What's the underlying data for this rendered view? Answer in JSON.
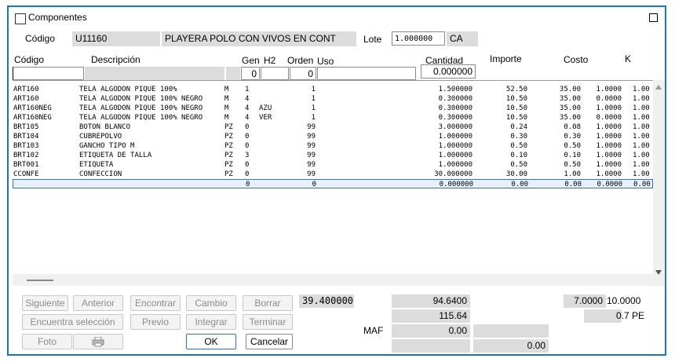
{
  "window": {
    "title": "Componentes"
  },
  "header": {
    "codigo_label": "Código",
    "codigo_value": "U11160",
    "descripcion_value": "PLAYERA POLO CON VIVOS EN CONT",
    "lote_label": "Lote",
    "lote_value": "1.000000",
    "unidad_value": "CA"
  },
  "columns": {
    "codigo": "Código",
    "descripcion": "Descripción",
    "gen": "Gen",
    "h2": "H2",
    "orden": "Orden",
    "uso": "Uso",
    "cantidad": "Cantidad",
    "importe": "Importe",
    "costo": "Costo",
    "k": "K"
  },
  "filters": {
    "codigo": "",
    "descripcion": "",
    "gen": "0",
    "h2": "",
    "orden": "0",
    "uso": "",
    "cantidad": "0.000000"
  },
  "rows": [
    {
      "codigo": "ART160",
      "desc": "TELA ALGODON PIQUE 100%",
      "um": "M",
      "gen": "1",
      "h2": "",
      "orden": "1",
      "cantidad": "1.500000",
      "importe": "52.50",
      "costo": "35.00",
      "k1": "1.0000",
      "k2": "1.00"
    },
    {
      "codigo": "ART160",
      "desc": "TELA ALGODON PIQUE 100% NEGRO",
      "um": "M",
      "gen": "4",
      "h2": "",
      "orden": "1",
      "cantidad": "0.300000",
      "importe": "10.50",
      "costo": "35.00",
      "k1": "0.0000",
      "k2": "1.00"
    },
    {
      "codigo": "ART160NEG",
      "desc": "TELA ALGODON PIQUE 100% NEGRO",
      "um": "M",
      "gen": "4",
      "h2": "AZU",
      "orden": "1",
      "cantidad": "0.300000",
      "importe": "10.50",
      "costo": "35.00",
      "k1": "1.0000",
      "k2": "1.00"
    },
    {
      "codigo": "ART160NEG",
      "desc": "TELA ALGODON PIQUE 100% NEGRO",
      "um": "M",
      "gen": "4",
      "h2": "VER",
      "orden": "1",
      "cantidad": "0.300000",
      "importe": "10.50",
      "costo": "35.00",
      "k1": "0.0000",
      "k2": "1.00"
    },
    {
      "codigo": "BRT105",
      "desc": "BOTON BLANCO",
      "um": "PZ",
      "gen": "0",
      "h2": "",
      "orden": "99",
      "cantidad": "3.000000",
      "importe": "0.24",
      "costo": "0.08",
      "k1": "1.0000",
      "k2": "1.00"
    },
    {
      "codigo": "BRT104",
      "desc": "CUBREPOLVO",
      "um": "PZ",
      "gen": "0",
      "h2": "",
      "orden": "99",
      "cantidad": "1.000000",
      "importe": "0.30",
      "costo": "0.30",
      "k1": "1.0000",
      "k2": "1.00"
    },
    {
      "codigo": "BRT103",
      "desc": "GANCHO TIPO M",
      "um": "PZ",
      "gen": "0",
      "h2": "",
      "orden": "99",
      "cantidad": "1.000000",
      "importe": "0.50",
      "costo": "0.50",
      "k1": "1.0000",
      "k2": "1.00"
    },
    {
      "codigo": "BRT102",
      "desc": "ETIQUETA DE TALLA",
      "um": "PZ",
      "gen": "3",
      "h2": "",
      "orden": "99",
      "cantidad": "1.000000",
      "importe": "0.10",
      "costo": "0.10",
      "k1": "1.0000",
      "k2": "1.00"
    },
    {
      "codigo": "BRT001",
      "desc": "ETIQUETA",
      "um": "PZ",
      "gen": "0",
      "h2": "",
      "orden": "99",
      "cantidad": "1.000000",
      "importe": "0.50",
      "costo": "0.50",
      "k1": "1.0000",
      "k2": "1.00"
    },
    {
      "codigo": "CCONFE",
      "desc": "CONFECCION",
      "um": "PZ",
      "gen": "0",
      "h2": "",
      "orden": "99",
      "cantidad": "30.000000",
      "importe": "30.00",
      "costo": "1.00",
      "k1": "1.0000",
      "k2": "1.00"
    },
    {
      "codigo": "",
      "desc": "",
      "um": "",
      "gen": "0",
      "h2": "",
      "orden": "0",
      "cantidad": "0.000000",
      "importe": "0.00",
      "costo": "0.00",
      "k1": "0.0000",
      "k2": "0.00"
    }
  ],
  "buttons": {
    "siguiente": "Siguiente",
    "anterior": "Anterior",
    "encontrar": "Encontrar",
    "cambio": "Cambio",
    "borrar": "Borrar",
    "encuentra_seleccion": "Encuentra selección",
    "previo": "Previo",
    "integrar": "Integrar",
    "terminar": "Terminar",
    "foto": "Foto",
    "ok": "OK",
    "cancelar": "Cancelar"
  },
  "totals": {
    "cantidad_total": "39.400000",
    "importe_total": "94.6400",
    "importe_lote": "115.64",
    "maf_label": "MAF",
    "maf_value": "0.00",
    "bottom_value": "0.00",
    "right_val1": "7.0000",
    "right_val2": "10.0000",
    "right_val3": "0.7 PE"
  },
  "icons": {
    "print": "printer-icon",
    "scroll_up": "up-arrow-icon",
    "scroll_down": "down-arrow-icon"
  }
}
